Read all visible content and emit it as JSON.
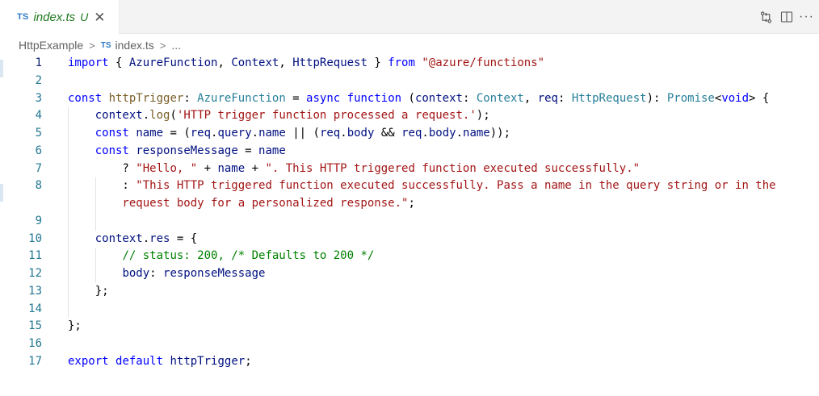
{
  "tab": {
    "badge": "TS",
    "filename": "index.ts",
    "status": "U",
    "close_glyph": "✕"
  },
  "tab_actions": {
    "compare_icon": "git-compare-icon",
    "split_icon": "split-editor-icon",
    "more": "···"
  },
  "breadcrumb": {
    "folder": "HttpExample",
    "separator": ">",
    "file_badge": "TS",
    "file": "index.ts",
    "ellipsis": "..."
  },
  "editor": {
    "lines": [
      {
        "num": "1",
        "tokens": [
          [
            "t-keyword",
            "import"
          ],
          [
            "t-plain",
            " { "
          ],
          [
            "t-var",
            "AzureFunction"
          ],
          [
            "t-plain",
            ", "
          ],
          [
            "t-var",
            "Context"
          ],
          [
            "t-plain",
            ", "
          ],
          [
            "t-var",
            "HttpRequest"
          ],
          [
            "t-plain",
            " } "
          ],
          [
            "t-keyword",
            "from"
          ],
          [
            "t-plain",
            " "
          ],
          [
            "t-string",
            "\"@azure/functions\""
          ]
        ]
      },
      {
        "num": "2",
        "tokens": []
      },
      {
        "num": "3",
        "tokens": [
          [
            "t-keyword",
            "const"
          ],
          [
            "t-plain",
            " "
          ],
          [
            "t-func",
            "httpTrigger"
          ],
          [
            "t-plain",
            ": "
          ],
          [
            "t-type",
            "AzureFunction"
          ],
          [
            "t-plain",
            " = "
          ],
          [
            "t-keyword",
            "async"
          ],
          [
            "t-plain",
            " "
          ],
          [
            "t-keyword",
            "function"
          ],
          [
            "t-plain",
            " ("
          ],
          [
            "t-var",
            "context"
          ],
          [
            "t-plain",
            ": "
          ],
          [
            "t-type",
            "Context"
          ],
          [
            "t-plain",
            ", "
          ],
          [
            "t-var",
            "req"
          ],
          [
            "t-plain",
            ": "
          ],
          [
            "t-type",
            "HttpRequest"
          ],
          [
            "t-plain",
            "): "
          ],
          [
            "t-type",
            "Promise"
          ],
          [
            "t-plain",
            "<"
          ],
          [
            "t-keyword",
            "void"
          ],
          [
            "t-plain",
            "> {"
          ]
        ]
      },
      {
        "num": "4",
        "tokens": [
          [
            "t-plain",
            "    "
          ],
          [
            "t-var",
            "context"
          ],
          [
            "t-plain",
            "."
          ],
          [
            "t-func",
            "log"
          ],
          [
            "t-plain",
            "("
          ],
          [
            "t-string",
            "'HTTP trigger function processed a request.'"
          ],
          [
            "t-plain",
            ");"
          ]
        ]
      },
      {
        "num": "5",
        "tokens": [
          [
            "t-plain",
            "    "
          ],
          [
            "t-keyword",
            "const"
          ],
          [
            "t-plain",
            " "
          ],
          [
            "t-var",
            "name"
          ],
          [
            "t-plain",
            " = ("
          ],
          [
            "t-var",
            "req"
          ],
          [
            "t-plain",
            "."
          ],
          [
            "t-var",
            "query"
          ],
          [
            "t-plain",
            "."
          ],
          [
            "t-var",
            "name"
          ],
          [
            "t-plain",
            " || ("
          ],
          [
            "t-var",
            "req"
          ],
          [
            "t-plain",
            "."
          ],
          [
            "t-var",
            "body"
          ],
          [
            "t-plain",
            " && "
          ],
          [
            "t-var",
            "req"
          ],
          [
            "t-plain",
            "."
          ],
          [
            "t-var",
            "body"
          ],
          [
            "t-plain",
            "."
          ],
          [
            "t-var",
            "name"
          ],
          [
            "t-plain",
            "));"
          ]
        ]
      },
      {
        "num": "6",
        "tokens": [
          [
            "t-plain",
            "    "
          ],
          [
            "t-keyword",
            "const"
          ],
          [
            "t-plain",
            " "
          ],
          [
            "t-var",
            "responseMessage"
          ],
          [
            "t-plain",
            " = "
          ],
          [
            "t-var",
            "name"
          ]
        ]
      },
      {
        "num": "7",
        "tokens": [
          [
            "t-plain",
            "        ? "
          ],
          [
            "t-string",
            "\"Hello, \""
          ],
          [
            "t-plain",
            " + "
          ],
          [
            "t-var",
            "name"
          ],
          [
            "t-plain",
            " + "
          ],
          [
            "t-string",
            "\". This HTTP triggered function executed successfully.\""
          ]
        ]
      },
      {
        "num": "8",
        "tokens": [
          [
            "t-plain",
            "        : "
          ],
          [
            "t-string",
            "\"This HTTP triggered function executed successfully. Pass a name in the query string or in the"
          ]
        ]
      },
      {
        "num": "",
        "tokens": [
          [
            "t-string",
            "        request body for a personalized response.\""
          ],
          [
            "t-plain",
            ";"
          ]
        ]
      },
      {
        "num": "9",
        "tokens": []
      },
      {
        "num": "10",
        "tokens": [
          [
            "t-plain",
            "    "
          ],
          [
            "t-var",
            "context"
          ],
          [
            "t-plain",
            "."
          ],
          [
            "t-var",
            "res"
          ],
          [
            "t-plain",
            " = {"
          ]
        ]
      },
      {
        "num": "11",
        "tokens": [
          [
            "t-plain",
            "        "
          ],
          [
            "t-comment",
            "// status: 200, /* Defaults to 200 */"
          ]
        ]
      },
      {
        "num": "12",
        "tokens": [
          [
            "t-plain",
            "        "
          ],
          [
            "t-var",
            "body"
          ],
          [
            "t-plain",
            ": "
          ],
          [
            "t-var",
            "responseMessage"
          ]
        ]
      },
      {
        "num": "13",
        "tokens": [
          [
            "t-plain",
            "    };"
          ]
        ]
      },
      {
        "num": "14",
        "tokens": []
      },
      {
        "num": "15",
        "tokens": [
          [
            "t-plain",
            "};"
          ]
        ]
      },
      {
        "num": "16",
        "tokens": []
      },
      {
        "num": "17",
        "tokens": [
          [
            "t-keyword",
            "export"
          ],
          [
            "t-plain",
            " "
          ],
          [
            "t-keyword",
            "default"
          ],
          [
            "t-plain",
            " "
          ],
          [
            "t-var",
            "httpTrigger"
          ],
          [
            "t-plain",
            ";"
          ]
        ]
      }
    ]
  }
}
